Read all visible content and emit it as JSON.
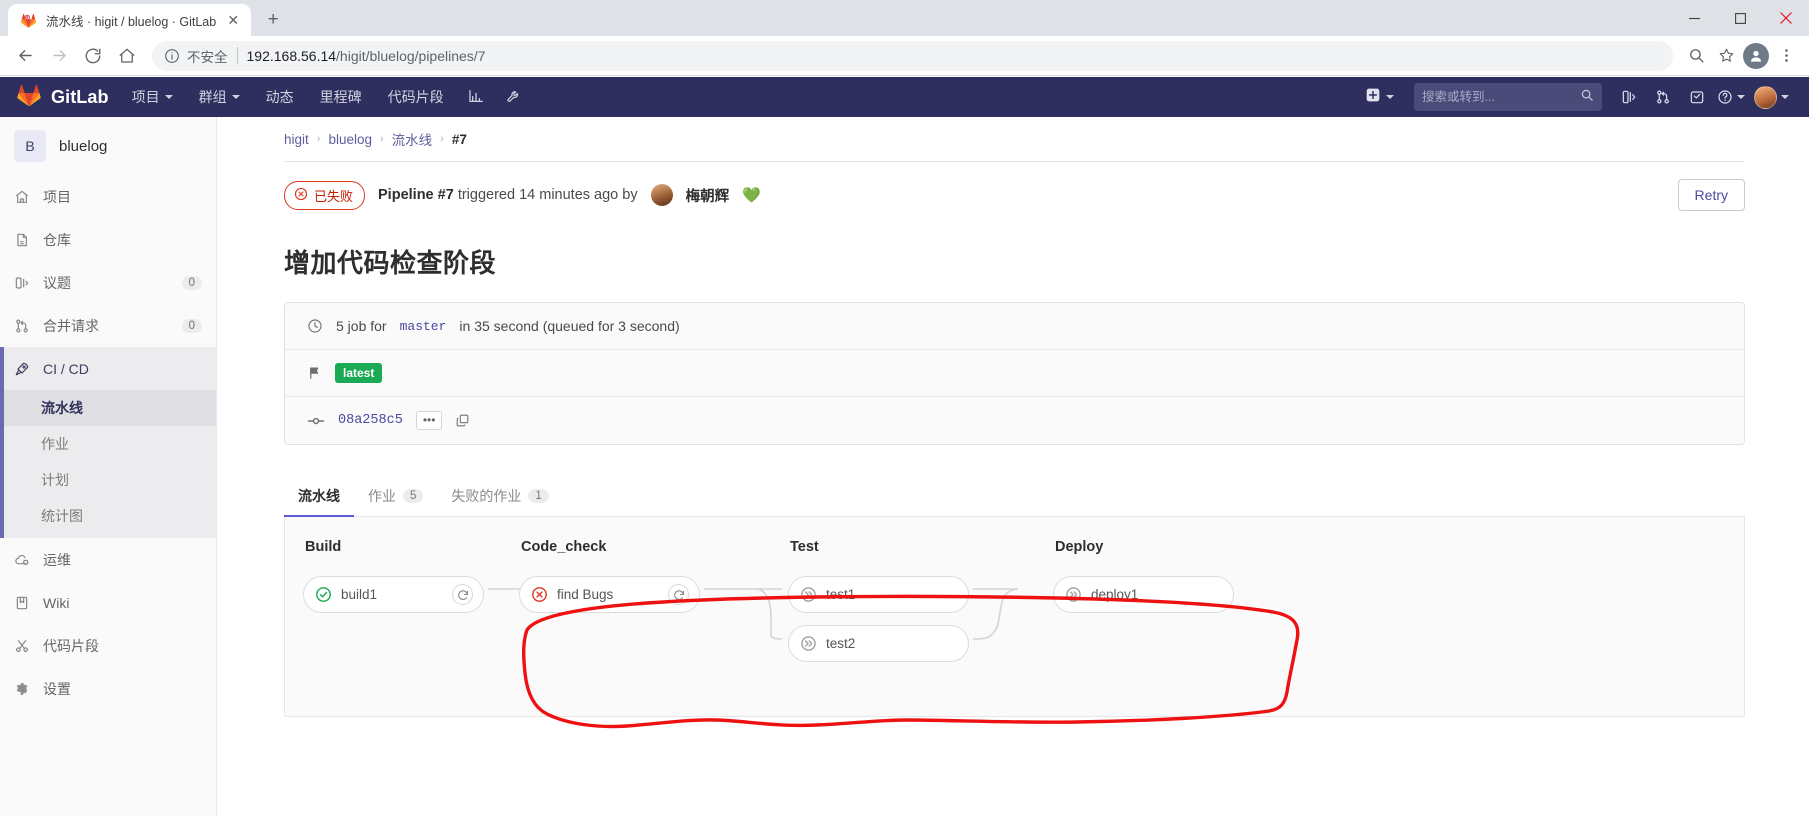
{
  "browser": {
    "tab_title": "流水线 · higit / bluelog · GitLab",
    "favicon": "gitlab-fox-favicon",
    "new_tab_label": "+",
    "close_tab_label": "✕",
    "back_label": "←",
    "forward_label": "→",
    "reload_label": "⟳",
    "home_label": "⌂",
    "insecure_label": "不安全",
    "url_host": "192.168.56.14",
    "url_path": "/higit/bluelog/pipelines/7",
    "zoom_icon": "zoom-search-icon",
    "bookmark_icon": "star-icon",
    "profile_icon": "profile-avatar-icon",
    "menu_icon": "three-dot-menu-icon",
    "window_minimize": "–",
    "window_maximize": "□",
    "window_close": "✕"
  },
  "gitlab_nav": {
    "brand": "GitLab",
    "items": [
      {
        "label": "项目",
        "has_caret": true
      },
      {
        "label": "群组",
        "has_caret": true
      },
      {
        "label": "动态",
        "has_caret": false
      },
      {
        "label": "里程碑",
        "has_caret": false
      },
      {
        "label": "代码片段",
        "has_caret": false
      }
    ],
    "icon_items": [
      {
        "name": "analytics-chart-icon"
      },
      {
        "name": "wrench-admin-icon"
      }
    ],
    "plus_label": "",
    "search_placeholder": "搜索或转到...",
    "search_value": "",
    "right_icons": [
      {
        "name": "issues-icon"
      },
      {
        "name": "merge-requests-icon"
      },
      {
        "name": "todos-icon"
      },
      {
        "name": "help-icon"
      }
    ]
  },
  "sidebar": {
    "project_initial": "B",
    "project_name": "bluelog",
    "items": [
      {
        "label": "项目",
        "icon": "home-icon",
        "count": null,
        "active": false
      },
      {
        "label": "仓库",
        "icon": "document-icon",
        "count": null,
        "active": false
      },
      {
        "label": "议题",
        "icon": "issues-icon",
        "count": "0",
        "active": false
      },
      {
        "label": "合并请求",
        "icon": "merge-request-icon",
        "count": "0",
        "active": false
      },
      {
        "label": "CI / CD",
        "icon": "rocket-icon",
        "count": null,
        "active": true
      }
    ],
    "subitems": [
      {
        "label": "流水线",
        "selected": true
      },
      {
        "label": "作业",
        "selected": false
      },
      {
        "label": "计划",
        "selected": false
      },
      {
        "label": "统计图",
        "selected": false
      }
    ],
    "items_after": [
      {
        "label": "运维",
        "icon": "cloud-gear-icon",
        "count": null
      },
      {
        "label": "Wiki",
        "icon": "book-icon",
        "count": null
      },
      {
        "label": "代码片段",
        "icon": "scissors-icon",
        "count": null
      },
      {
        "label": "设置",
        "icon": "gear-icon",
        "count": null
      }
    ]
  },
  "breadcrumb": {
    "group": "higit",
    "project": "bluelog",
    "section": "流水线",
    "current": "#7",
    "separator": "›"
  },
  "pipeline_header": {
    "status_badge": "已失败",
    "status_icon": "failed-x-circle-icon",
    "text_prefix": "Pipeline",
    "pipeline_number": "#7",
    "text_middle": "triggered 14 minutes ago by",
    "user_name": "梅朝辉",
    "user_emoji": "💚",
    "retry_label": "Retry"
  },
  "commit": {
    "title": "增加代码检查阶段",
    "jobs_summary": "5 job for master in 35 second (queued for 3 second)",
    "jobs_summary_parts": {
      "before": "5 job for",
      "ref": "master",
      "after": "in 35 second (queued for 3 second)"
    },
    "clock_icon": "clock-icon",
    "flag_icon": "flag-icon",
    "tag": "latest",
    "commit_icon": "commit-node-icon",
    "sha": "08a258c5",
    "ellipsis_label": "•••",
    "copy_icon": "copy-icon"
  },
  "tabs": [
    {
      "label": "流水线",
      "count": null,
      "active": true
    },
    {
      "label": "作业",
      "count": "5",
      "active": false
    },
    {
      "label": "失败的作业",
      "count": "1",
      "active": false
    }
  ],
  "pipeline_graph": {
    "stages": [
      {
        "name": "Build",
        "jobs": [
          {
            "name": "build1",
            "status": "success",
            "status_icon": "check-circle-icon",
            "action_icon": "retry-refresh-icon"
          }
        ]
      },
      {
        "name": "Code_check",
        "jobs": [
          {
            "name": "find Bugs",
            "status": "failed",
            "status_icon": "failed-x-circle-icon",
            "action_icon": "retry-refresh-icon"
          }
        ]
      },
      {
        "name": "Test",
        "jobs": [
          {
            "name": "test1",
            "status": "skipped",
            "status_icon": "skipped-chevrons-icon",
            "action_icon": null
          },
          {
            "name": "test2",
            "status": "skipped",
            "status_icon": "skipped-chevrons-icon",
            "action_icon": null
          }
        ]
      },
      {
        "name": "Deploy",
        "jobs": [
          {
            "name": "deploy1",
            "status": "skipped",
            "status_icon": "skipped-chevrons-icon",
            "action_icon": null
          }
        ]
      }
    ]
  },
  "annotation": {
    "type": "hand-drawn-red-circle",
    "color": "#ee1111",
    "covers": "Code_check, Test and Deploy stages"
  },
  "colors": {
    "gitlab_navy": "#2e2e5f",
    "accent_purple": "#6b6bb5",
    "link_blue": "#4a4aa0",
    "success_green": "#1aaa55",
    "failed_red": "#db3b21",
    "annotation_red": "#ee1111",
    "sidebar_bg": "#fafafa",
    "panel_bg": "#fafafa"
  }
}
